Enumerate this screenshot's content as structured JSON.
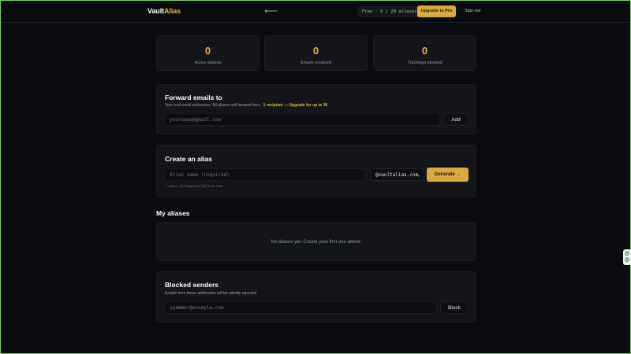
{
  "header": {
    "brand_part1": "Vault",
    "brand_part2": "Alias",
    "back_glyph": "⟵",
    "plan": "Free · 0 / 20 aliases",
    "upgrade_label": "Upgrade to Pro",
    "signout_label": "Sign out"
  },
  "stats": [
    {
      "value": "0",
      "label": "Active aliases"
    },
    {
      "value": "0",
      "label": "Emails received"
    },
    {
      "value": "0",
      "label": "Trackings blocked"
    }
  ],
  "forward": {
    "title": "Forward emails to",
    "description": "Your real email addresses. All aliases will forward here.",
    "limit_note": "1 recipient — Upgrade for up to 30",
    "placeholder": "yourname@gmail.com",
    "add_label": "Add"
  },
  "create": {
    "title": "Create an alias",
    "placeholder": "Alias name (required)",
    "domain": "@vaultalias.com",
    "generate_label": "Generate →",
    "preview": "→ your-alias@vaultalias.com"
  },
  "aliases": {
    "title": "My aliases",
    "empty_message": "No aliases yet. Create your first one above."
  },
  "blocked": {
    "title": "Blocked senders",
    "description": "Emails from these addresses will be silently rejected.",
    "placeholder": "spammer@example.com",
    "block_label": "Block"
  },
  "colors": {
    "accent": "#d9ab3f",
    "background": "#0a0b0e",
    "card": "#13151a"
  }
}
